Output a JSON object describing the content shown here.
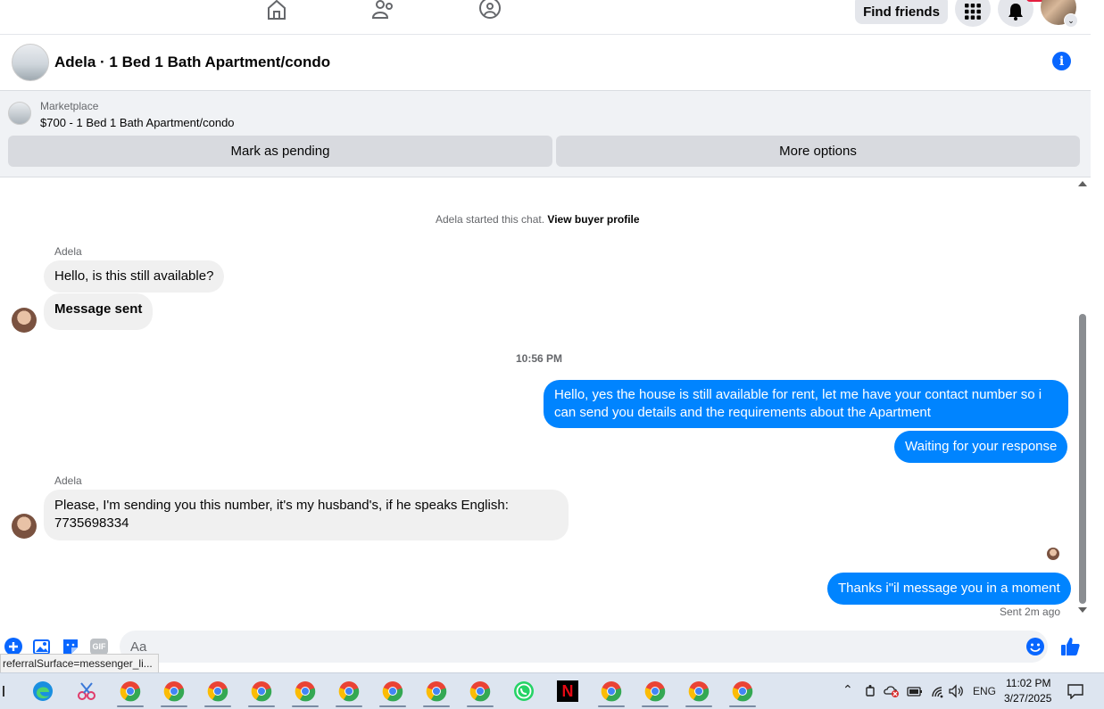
{
  "nav": {
    "find_friends": "Find friends",
    "icons": [
      "home-icon",
      "friends-icon",
      "groups-icon"
    ]
  },
  "header": {
    "title": "Adela · 1 Bed 1 Bath Apartment/condo"
  },
  "marketplace": {
    "label": "Marketplace",
    "listing": "$700 - 1 Bed 1 Bath Apartment/condo",
    "mark_pending": "Mark as pending",
    "more_options": "More options"
  },
  "chat": {
    "system_text": "Adela started this chat.",
    "system_link": "View buyer profile",
    "sender1": "Adela",
    "msg1": "Hello, is this still available?",
    "msg2": "Message sent",
    "time1": "10:56 PM",
    "out1": "Hello, yes the house is still available for rent, let me have your contact number so i can send you details and the requirements about the  Apartment",
    "out2": "Waiting for your response",
    "sender2": "Adela",
    "msg3": "Please, I'm sending you this number, it's my husband's, if he speaks English: 7735698334",
    "out3": "Thanks i\"il message you in a moment",
    "sent_status": "Sent 2m ago"
  },
  "composer": {
    "placeholder": "Aa",
    "gif_label": "GIF"
  },
  "status_tip": "referralSurface=messenger_li...",
  "taskbar": {
    "lang": "ENG",
    "time": "11:02 PM",
    "date": "3/27/2025"
  },
  "colors": {
    "accent": "#0866ff",
    "outgoing_bubble": "#0084ff",
    "incoming_bubble": "#f0f0f0"
  }
}
